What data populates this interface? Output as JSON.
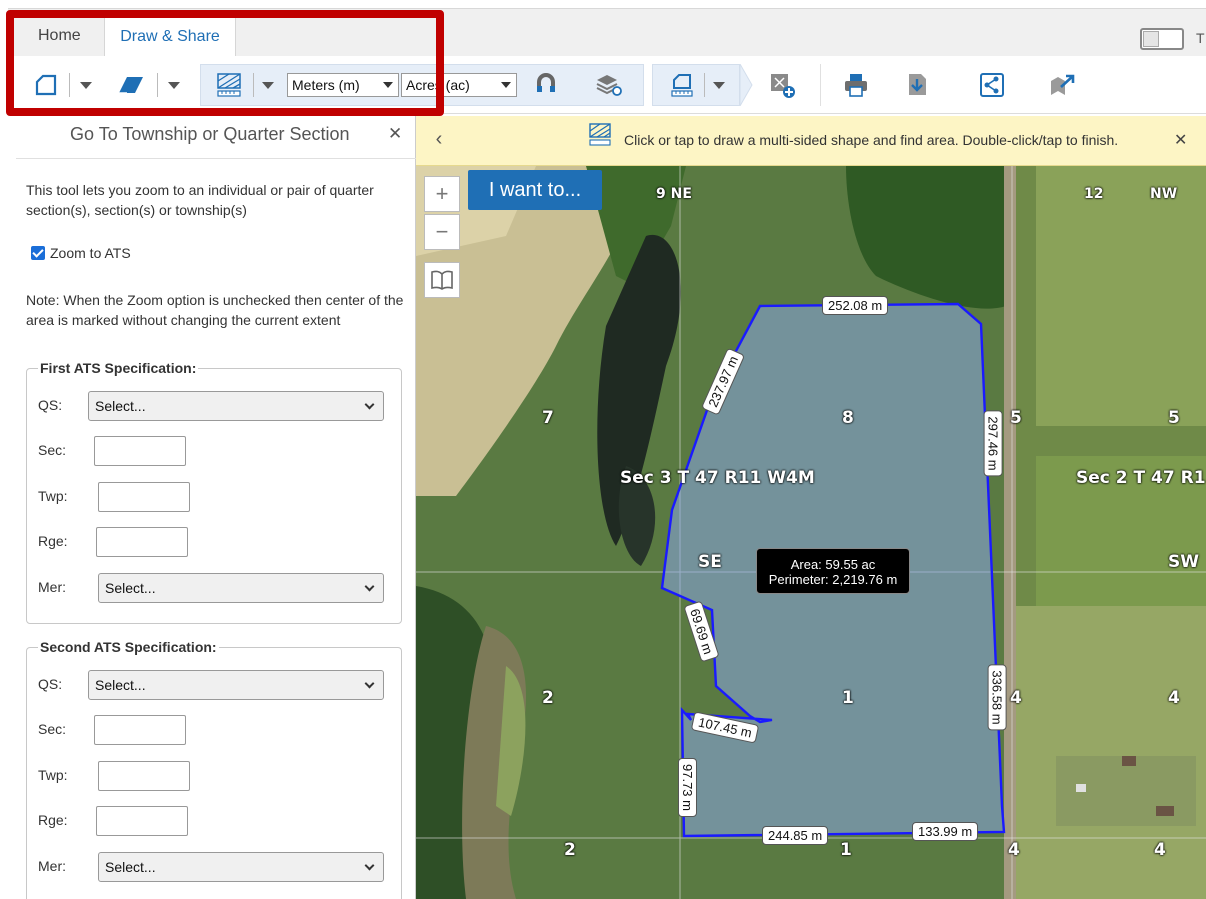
{
  "ribbon": {
    "tabs": [
      {
        "label": "Home",
        "active": false
      },
      {
        "label": "Draw & Share",
        "active": true
      }
    ],
    "toggle_label_partial": "T"
  },
  "toolbar": {
    "distance_unit": "Meters (m)",
    "area_unit": "Acres (ac)",
    "icons": [
      "draw-shape-icon",
      "eraser-icon",
      "measure-area-icon",
      "magnet-snap-icon",
      "layers-icon",
      "measure-shape-icon",
      "add-point-icon",
      "print-icon",
      "export-icon",
      "share-icon",
      "send-to-icon"
    ]
  },
  "panel": {
    "title": "Go To Township or Quarter Section",
    "intro": "This tool lets you zoom to an individual or pair of quarter section(s), section(s) or township(s)",
    "zoom_label": "Zoom to ATS",
    "zoom_checked": true,
    "note": "Note: When the Zoom option is unchecked then center of the area is marked without changing the current extent",
    "first": {
      "legend": "First ATS Specification:",
      "qs_label": "QS:",
      "qs_value": "Select...",
      "sec_label": "Sec:",
      "twp_label": "Twp:",
      "rge_label": "Rge:",
      "mer_label": "Mer:",
      "mer_value": "Select..."
    },
    "second": {
      "legend": "Second ATS Specification:",
      "qs_label": "QS:",
      "qs_value": "Select...",
      "sec_label": "Sec:",
      "twp_label": "Twp:",
      "rge_label": "Rge:",
      "mer_label": "Mer:",
      "mer_value": "Select..."
    }
  },
  "map": {
    "hint": "Click or tap to draw a multi-sided shape and find area. Double-click/tap to finish.",
    "iwant": "I want to...",
    "zoom_in": "+",
    "zoom_out": "−",
    "section_labels": {
      "ne9": "9 NE",
      "n12": "12",
      "nw": "NW",
      "s7": "7",
      "s8": "8",
      "s5a": "5",
      "s5b": "5",
      "sec3": "Sec 3 T 47 R11 W4M",
      "sec2": "Sec 2 T 47 R1",
      "se": "SE",
      "sw": "SW",
      "s2a": "2",
      "s1a": "1",
      "s4a": "4",
      "s4b": "4",
      "s2b": "2",
      "s1b": "1",
      "s4c": "4",
      "s4d": "4"
    },
    "dimensions": {
      "top": "252.08 m",
      "upper_left": "237.97 m",
      "right_upper": "297.46 m",
      "mid_left": "69.69 m",
      "notch": "107.45 m",
      "right_lower": "336.58 m",
      "lower_left": "97.73 m",
      "bottom_left": "244.85 m",
      "bottom_right": "133.99 m"
    },
    "measurement": {
      "area": "Area: 59.55 ac",
      "perimeter": "Perimeter: 2,219.76 m"
    },
    "colors": {
      "polygon_stroke": "#1a1aff",
      "polygon_fill": "#8aa6e6",
      "accent": "#1f6fb5",
      "highlight": "#c00000"
    }
  }
}
